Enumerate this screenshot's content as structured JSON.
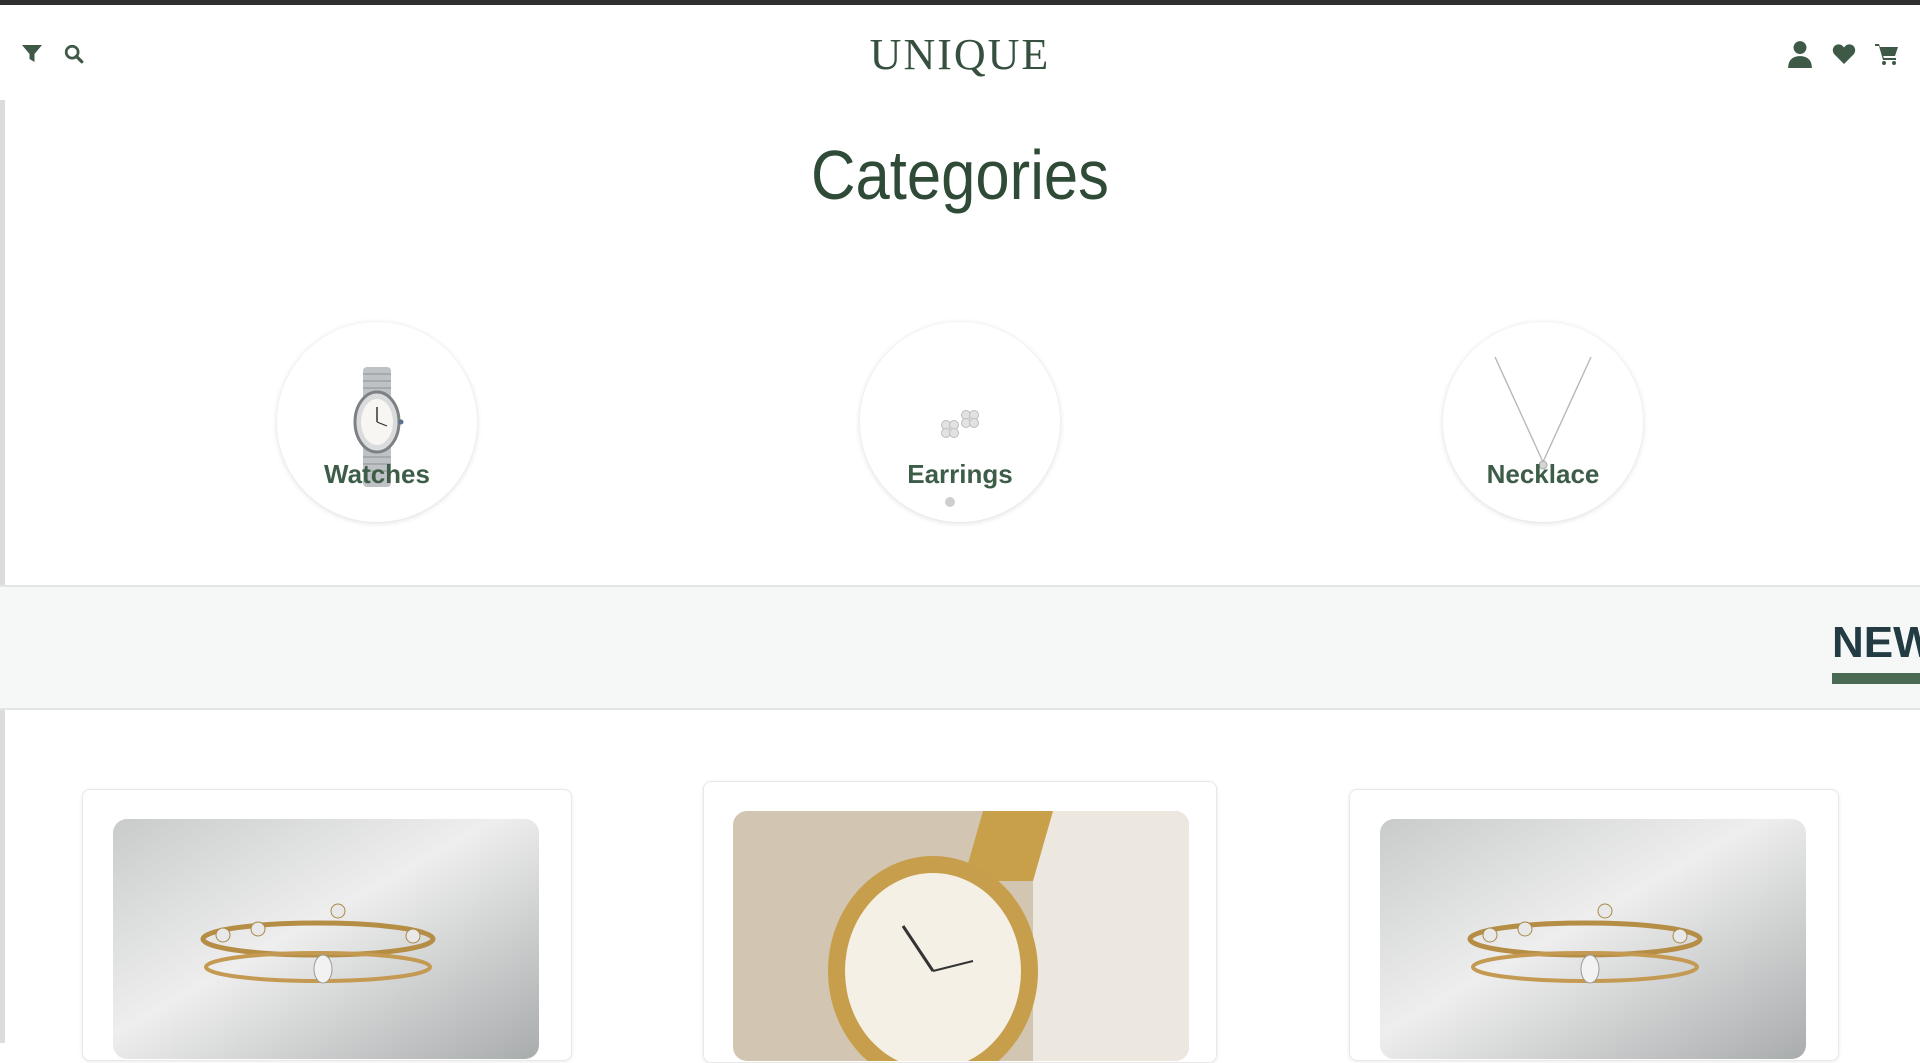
{
  "header": {
    "logo": "UNIQUE",
    "icons": [
      "filter-icon",
      "search-icon",
      "user-icon",
      "heart-icon",
      "cart-icon"
    ]
  },
  "categories": {
    "title": "Categories",
    "items": [
      {
        "label": "Watches",
        "icon": "watch-image"
      },
      {
        "label": "Earrings",
        "icon": "earrings-image"
      },
      {
        "label": "Necklace",
        "icon": "necklace-image"
      }
    ]
  },
  "new_section": {
    "title": "NEW"
  },
  "products": [
    {
      "image": "ring-set-image"
    },
    {
      "image": "gold-watch-image"
    },
    {
      "image": "ring-set-image"
    }
  ],
  "colors": {
    "brand_green": "#3e5d48",
    "band_background": "#f6f8f8",
    "underline": "#4b6a53"
  }
}
